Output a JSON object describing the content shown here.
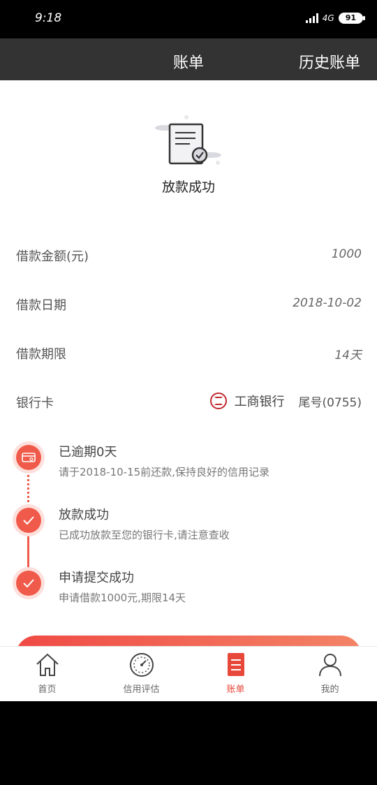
{
  "status": {
    "time": "9:18",
    "network": "4G",
    "battery": "91"
  },
  "header": {
    "title": "账单",
    "history_label": "历史账单"
  },
  "hero": {
    "title": "放款成功"
  },
  "details": {
    "amount_label": "借款金额(元)",
    "amount_value": "1000",
    "date_label": "借款日期",
    "date_value": "2018-10-02",
    "term_label": "借款期限",
    "term_value": "14天",
    "card_label": "银行卡",
    "bank_name": "工商银行",
    "card_tail": "尾号(0755)"
  },
  "timeline": [
    {
      "title": "已逾期0天",
      "desc": "请于2018-10-15前还款,保持良好的信用记录",
      "icon": "card-icon"
    },
    {
      "title": "放款成功",
      "desc": "已成功放款至您的银行卡,请注意查收",
      "icon": "check-icon"
    },
    {
      "title": "申请提交成功",
      "desc": "申请借款1000元,期限14天",
      "icon": "check-icon"
    }
  ],
  "tabs": [
    {
      "label": "首页",
      "icon": "home-icon"
    },
    {
      "label": "信用评估",
      "icon": "gauge-icon"
    },
    {
      "label": "账单",
      "icon": "bill-icon",
      "active": true
    },
    {
      "label": "我的",
      "icon": "user-icon"
    }
  ],
  "colors": {
    "accent": "#f05a4a",
    "navbar": "#333333",
    "active_tab": "#e8483a"
  }
}
